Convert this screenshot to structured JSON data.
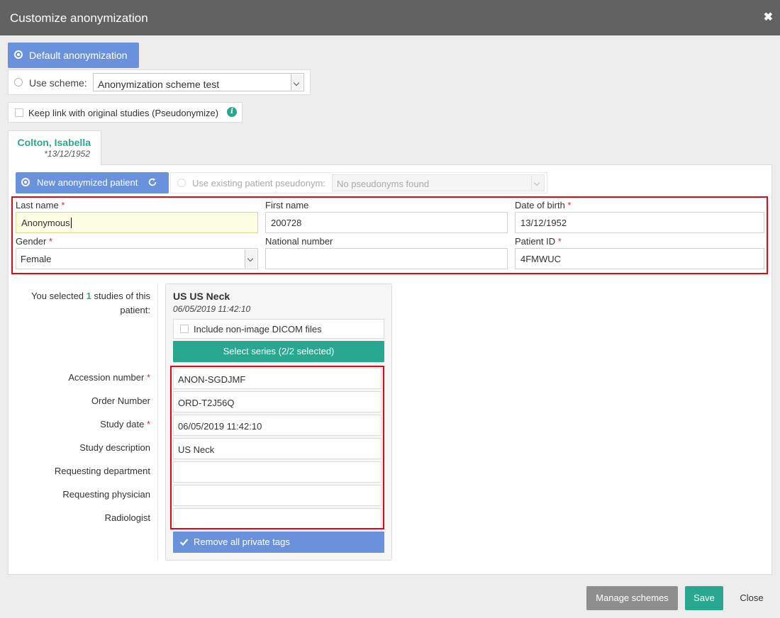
{
  "dialog": {
    "title": "Customize anonymization",
    "close_icon": "close-icon"
  },
  "anonymization": {
    "default_label": "Default anonymization",
    "default_selected": true,
    "scheme_label": "Use scheme:",
    "scheme_value": "Anonymization scheme test",
    "pseudonymize_label": "Keep link with original studies (Pseudonymize)",
    "pseudonymize_checked": false
  },
  "patient_tab": {
    "name": "Colton, Isabella",
    "dob": "*13/12/1952"
  },
  "patient_mode": {
    "new_label": "New anonymized patient",
    "existing_label": "Use existing patient pseudonym:",
    "existing_placeholder": "No pseudonyms found"
  },
  "patient_fields": {
    "last_name_label": "Last name",
    "last_name_value": "Anonymous",
    "first_name_label": "First name",
    "first_name_value": "200728",
    "dob_label": "Date of birth",
    "dob_value": "13/12/1952",
    "gender_label": "Gender",
    "gender_value": "Female",
    "national_number_label": "National number",
    "national_number_value": "",
    "patient_id_label": "Patient ID",
    "patient_id_value": "4FMWUC",
    "required_marker": "*"
  },
  "selection": {
    "prefix": "You selected ",
    "count": "1",
    "suffix": " studies of this patient:"
  },
  "study": {
    "title": "US US Neck",
    "datetime": "06/05/2019 11:42:10",
    "nonimage_label": "Include non-image DICOM files",
    "nonimage_checked": false,
    "select_series_label": "Select series (2/2 selected)",
    "fields": [
      {
        "label": "Accession number",
        "required": "*",
        "value": "ANON-SGDJMF"
      },
      {
        "label": "Order Number",
        "required": "",
        "value": "ORD-T2J56Q"
      },
      {
        "label": "Study date",
        "required": "*",
        "value": "06/05/2019 11:42:10"
      },
      {
        "label": "Study description",
        "required": "",
        "value": "US Neck"
      },
      {
        "label": "Requesting department",
        "required": "",
        "value": ""
      },
      {
        "label": "Requesting physician",
        "required": "",
        "value": ""
      },
      {
        "label": "Radiologist",
        "required": "",
        "value": ""
      }
    ],
    "remove_private_label": "Remove all private tags",
    "remove_private_checked": true
  },
  "footer": {
    "manage_label": "Manage schemes",
    "save_label": "Save",
    "close_label": "Close"
  },
  "colors": {
    "accent_blue": "#6a92dc",
    "accent_teal": "#2aa88f",
    "highlight_red": "#e30613",
    "titlebar": "#626262"
  }
}
